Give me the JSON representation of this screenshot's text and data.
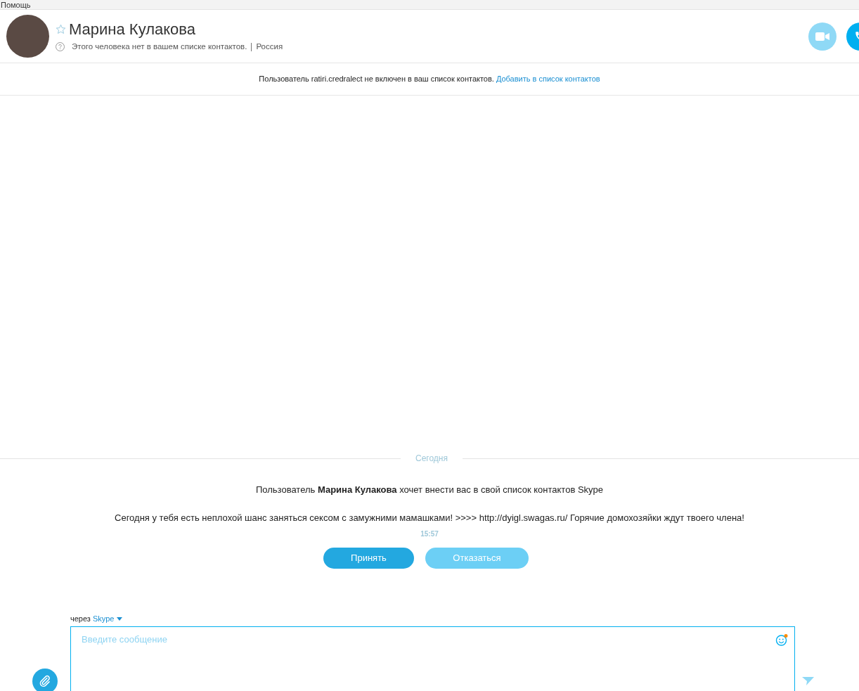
{
  "menu": {
    "label": "Помощь"
  },
  "contact": {
    "name": "Марина Кулакова",
    "favorite": false,
    "status": "Этого человека нет в вашем списке контактов.",
    "location": "Россия"
  },
  "call_buttons": [
    {
      "kind": "video",
      "enabled": false
    },
    {
      "kind": "audio",
      "enabled": true
    }
  ],
  "notice": {
    "text": "Пользователь ratiri.credralect не включен в ваш список контактов.",
    "link": "Добавить в список контактов"
  },
  "conversation": {
    "date_divider": "Сегодня",
    "request": "Пользователь **Марина Кулакова** хочет внести вас в свой список контактов Skype",
    "message": "Сегодня у тебя есть неплохой шанс заняться сексом с замужними мамашками! >>>> http://dyigl.swagas.ru/ Горячие домохозяйки ждут твоего члена!",
    "time": "15:57",
    "buttons": [
      {
        "label": "Принять",
        "kind": "primary"
      },
      {
        "label": "Отказаться",
        "kind": "secondary"
      }
    ]
  },
  "composer": {
    "via_label": "через",
    "via_service": "Skype",
    "placeholder": "Введите сообщение",
    "emoji_notification": true
  }
}
